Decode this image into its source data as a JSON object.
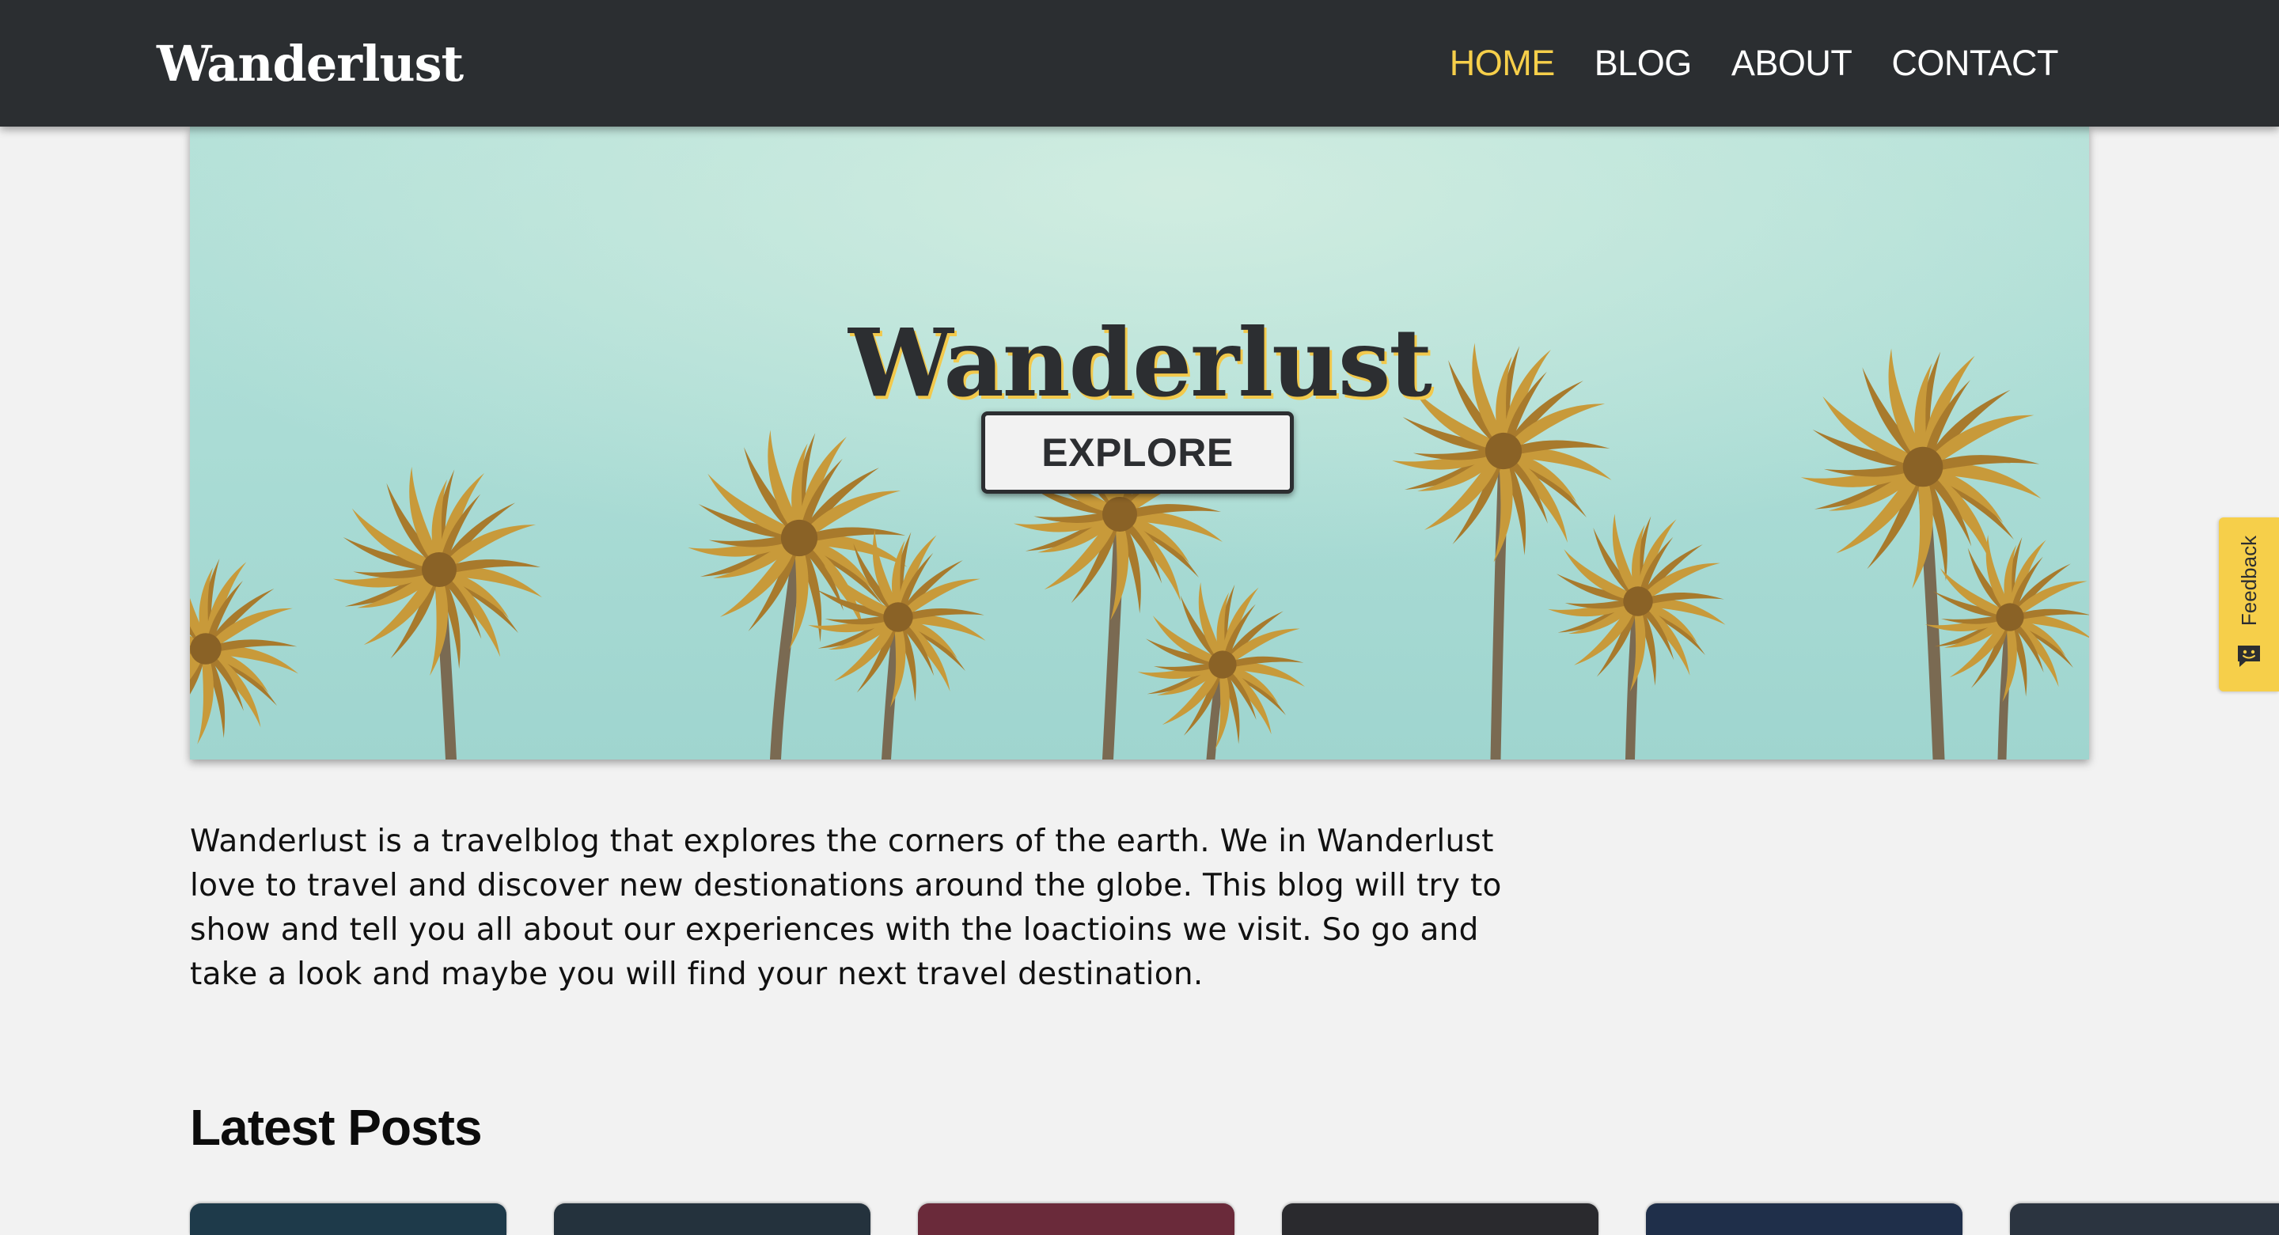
{
  "header": {
    "logo": "Wanderlust",
    "nav": [
      {
        "label": "HOME",
        "active": true
      },
      {
        "label": "BLOG",
        "active": false
      },
      {
        "label": "ABOUT",
        "active": false
      },
      {
        "label": "CONTACT",
        "active": false
      }
    ]
  },
  "hero": {
    "title": "Wanderlust",
    "button_label": "EXPLORE",
    "image": "palm-trees-sky-photo"
  },
  "intro": {
    "text": "Wanderlust is a travelblog that explores the corners of the earth. We in Wanderlust love to travel and discover new destionations around the globe. This blog will try to show and tell you all about our experiences with the loactioins we visit. So go and take a look and maybe you will find your next travel destination."
  },
  "latest_posts": {
    "heading": "Latest Posts"
  },
  "feedback": {
    "label": "Feedback",
    "icon": "feedback-face-icon"
  },
  "colors": {
    "header_bg": "#2b2e31",
    "accent": "#f6cf4a",
    "page_bg": "#f2f2f2",
    "text_dark": "#2c2e31",
    "sky": "#a9ddd6"
  }
}
